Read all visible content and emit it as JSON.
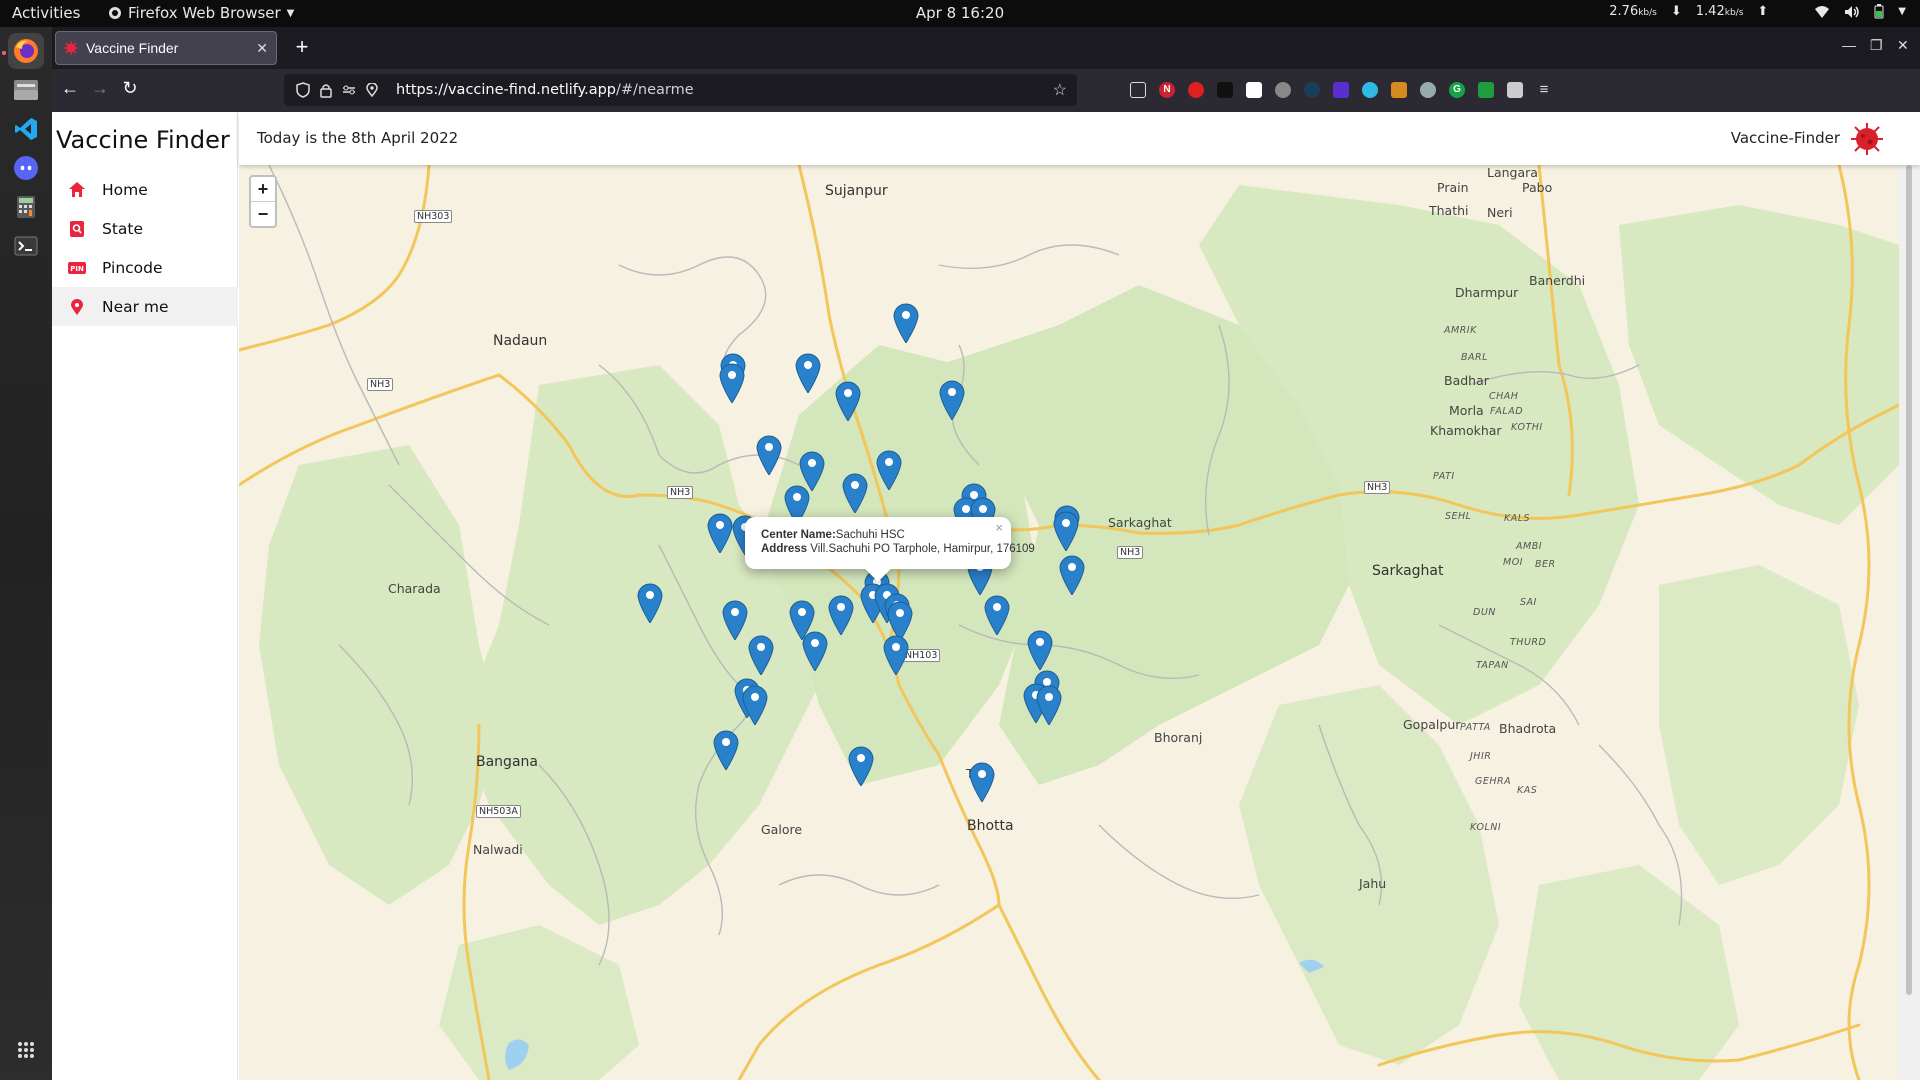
{
  "topbar": {
    "activities": "Activities",
    "app": "Firefox Web Browser",
    "clock": "Apr 8  16:20",
    "down_rate": "2.76",
    "up_rate": "1.42",
    "rate_unit": "kb/s"
  },
  "browser": {
    "tab_title": "Vaccine Finder",
    "url_host": "https://vaccine-find.netlify.app",
    "url_path": "/#/nearme"
  },
  "sidebar": {
    "brand": "Vaccine Finder",
    "items": [
      {
        "label": "Home",
        "icon": "home-icon"
      },
      {
        "label": "State",
        "icon": "search-location-icon"
      },
      {
        "label": "Pincode",
        "icon": "pin-badge-icon"
      },
      {
        "label": "Near me",
        "icon": "map-marker-icon"
      }
    ]
  },
  "header": {
    "date": "Today is the 8th April 2022",
    "appname": "Vaccine-Finder"
  },
  "map": {
    "zoom_in": "+",
    "zoom_out": "−",
    "places": [
      "Sujanpur",
      "Nadaun",
      "Charada",
      "Bangana",
      "Nalwadi",
      "Galore",
      "Bhotta",
      "Bhoranj",
      "Sarkaghat",
      "Dharmpur",
      "Banerdhi",
      "Langara",
      "Prain",
      "Pabo",
      "Thathi",
      "Neri",
      "Badhar",
      "Morla",
      "Khamokhar",
      "Gopalpur",
      "Bhadrota",
      "Jahu"
    ],
    "localities": [
      "AMRIK",
      "BARL",
      "CHAH",
      "FALAD",
      "KOTHI",
      "PATI",
      "SEHL",
      "KALS",
      "AMBI",
      "MOI",
      "BER",
      "SAI",
      "DUN",
      "THURD",
      "TAPAN",
      "PATTA",
      "JHIR",
      "GEHRA",
      "KAS",
      "KOLNI"
    ],
    "roads": [
      "NH303",
      "NH3",
      "NH3",
      "NH3",
      "NH3",
      "NH103",
      "NH503A"
    ],
    "partial_labels": [
      "ur",
      "T"
    ],
    "accent": "#2a81cb",
    "background_color": "#f7f1e1"
  },
  "popup": {
    "name_label": "Center Name:",
    "name_value": "Sachuhi HSC",
    "address_label": "Address",
    "address_value": "Vill.Sachuhi PO Tarphole, Hamirpur, 176109",
    "close": "×"
  }
}
